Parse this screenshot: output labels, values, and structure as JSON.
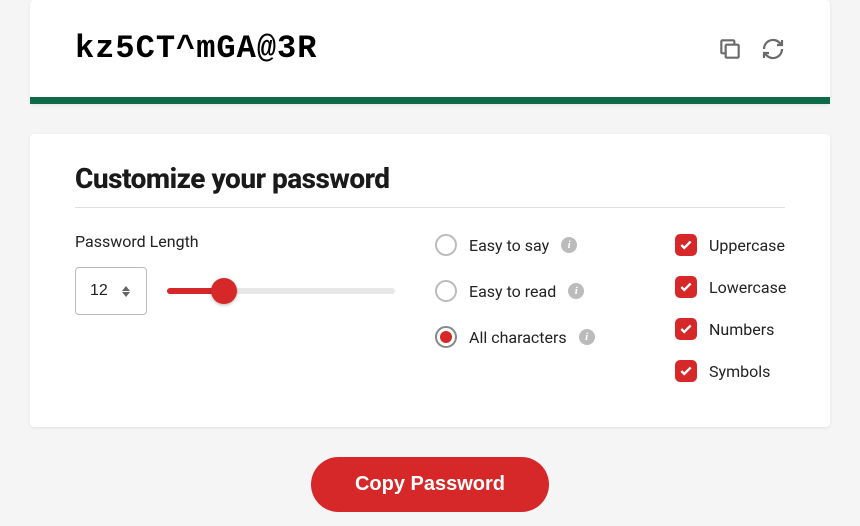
{
  "generated_password": "kz5CT^mGA@3R",
  "customize": {
    "title": "Customize your password",
    "length_label": "Password Length",
    "length_value": "12",
    "radios": [
      {
        "label": "Easy to say",
        "checked": false
      },
      {
        "label": "Easy to read",
        "checked": false
      },
      {
        "label": "All characters",
        "checked": true
      }
    ],
    "checkboxes": [
      {
        "label": "Uppercase",
        "checked": true
      },
      {
        "label": "Lowercase",
        "checked": true
      },
      {
        "label": "Numbers",
        "checked": true
      },
      {
        "label": "Symbols",
        "checked": true
      }
    ]
  },
  "copy_button_label": "Copy Password"
}
